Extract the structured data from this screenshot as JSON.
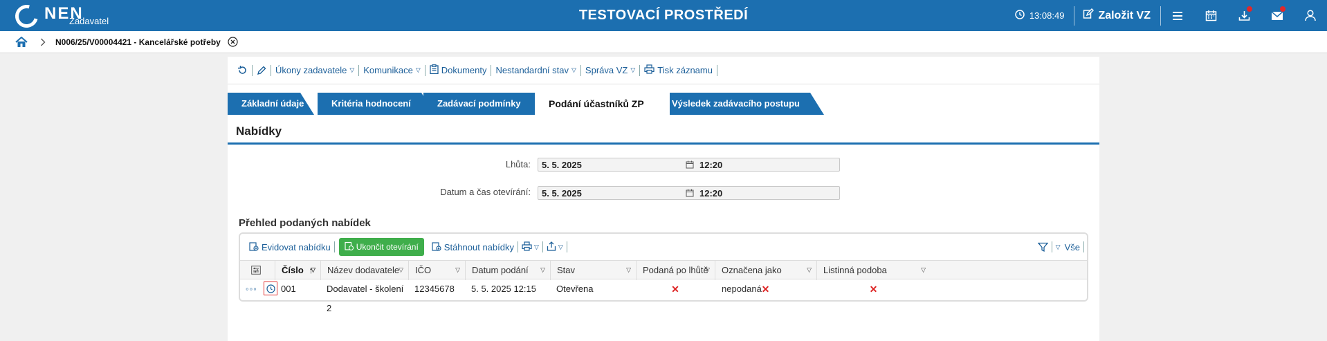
{
  "app": {
    "logo_text": "NEN",
    "logo_sub": "Zadavatel",
    "env_title": "TESTOVACÍ PROSTŘEDÍ",
    "clock": "13:08:49",
    "create_label": "Založit VZ",
    "colors": {
      "brand": "#1c6fb0",
      "success": "#3fae4b",
      "notify": "#e0282b"
    }
  },
  "breadcrumb": {
    "text": "N006/25/V00004421 - Kancelářské potřeby"
  },
  "toolbar": {
    "ukony": "Úkony zadavatele",
    "komunikace": "Komunikace",
    "dokumenty": "Dokumenty",
    "nestandardni": "Nestandardní stav",
    "sprava": "Správa VZ",
    "tisk": "Tisk záznamu"
  },
  "tabs": [
    {
      "label": "Základní údaje"
    },
    {
      "label": "Kritéria hodnocení"
    },
    {
      "label": "Zadávací podmínky"
    },
    {
      "label": "Podání účastníků ZP",
      "active": true
    },
    {
      "label": "Výsledek zadávacího postupu"
    }
  ],
  "section": {
    "title": "Nabídky"
  },
  "fields": {
    "lhuta": {
      "label": "Lhůta:",
      "date": "5. 5. 2025",
      "time": "12:20"
    },
    "otevirani": {
      "label": "Datum a čas otevírání:",
      "date": "5. 5. 2025",
      "time": "12:20"
    }
  },
  "grid": {
    "title": "Přehled podaných nabídek",
    "actions": {
      "evidovat": "Evidovat nabídku",
      "ukoncit": "Ukončit otevírání",
      "stahnout": "Stáhnout nabídky",
      "filter_all": "Vše"
    },
    "columns": [
      "Číslo",
      "Název dodavatele",
      "IČO",
      "Datum podání",
      "Stav",
      "Podaná po lhůtě",
      "Označena jako nepodaná",
      "Listinná podoba"
    ],
    "rows": [
      {
        "cislo": "001",
        "nazev": "Dodavatel - školení 2",
        "ico": "12345678",
        "datum": "5. 5. 2025 12:15",
        "stav": "Otevřena",
        "po_lhute": "✕",
        "nepodana": "✕",
        "listinna": "✕"
      }
    ]
  }
}
